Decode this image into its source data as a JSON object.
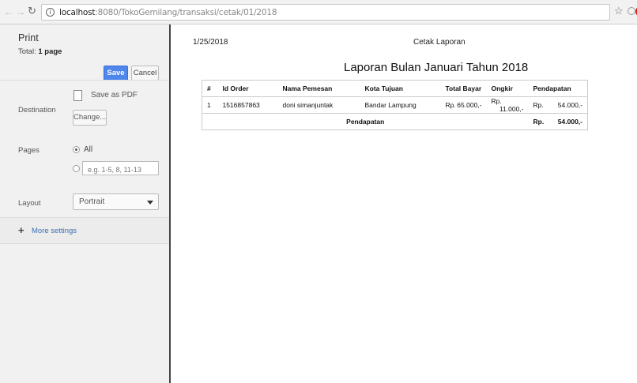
{
  "browser": {
    "url_host": "localhost",
    "url_path": ":8080/TokoGemilang/transaksi/cetak/01/2018"
  },
  "print_panel": {
    "title": "Print",
    "total_label": "Total:",
    "total_value": "1 page",
    "save_label": "Save",
    "cancel_label": "Cancel",
    "destination_label": "Destination",
    "destination_value": "Save as PDF",
    "change_label": "Change...",
    "pages_label": "Pages",
    "pages_all_label": "All",
    "pages_placeholder": "e.g. 1-5, 8, 11-13",
    "layout_label": "Layout",
    "layout_value": "Portrait",
    "more_settings_label": "More settings"
  },
  "preview": {
    "date": "1/25/2018",
    "header": "Cetak Laporan",
    "title": "Laporan Bulan Januari Tahun 2018",
    "columns": [
      "#",
      "Id Order",
      "Nama Pemesan",
      "Kota Tujuan",
      "Total Bayar",
      "Ongkir",
      "Pendapatan"
    ],
    "rows": [
      {
        "no": "1",
        "id_order": "1516857863",
        "nama": "doni simanjuntak",
        "kota": "Bandar Lampung",
        "total_cur": "Rp.",
        "total_val": "65.000,-",
        "ongkir_cur": "Rp.",
        "ongkir_val": "11.000,-",
        "pendapatan_cur": "Rp.",
        "pendapatan_val": "54.000,-"
      }
    ],
    "footer": {
      "label": "Pendapatan",
      "cur": "Rp.",
      "val": "54.000,-"
    }
  }
}
